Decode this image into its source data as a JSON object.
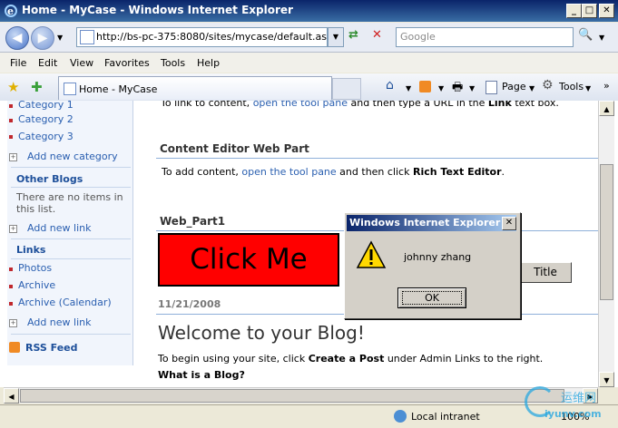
{
  "window": {
    "title": "Home - MyCase - Windows Internet Explorer",
    "caption_buttons": [
      "_",
      "□",
      "✕"
    ]
  },
  "address": {
    "url": "http://bs-pc-375:8080/sites/mycase/default.aspx"
  },
  "search": {
    "placeholder": "Google"
  },
  "menu": [
    "File",
    "Edit",
    "View",
    "Favorites",
    "Tools",
    "Help"
  ],
  "tab": {
    "label": "Home - MyCase"
  },
  "toolbar": {
    "page_label": "Page",
    "tools_label": "Tools"
  },
  "leftnav": {
    "categories": [
      "Category 1",
      "Category 2",
      "Category 3"
    ],
    "add_category": "Add new category",
    "other_blogs_heading": "Other Blogs",
    "other_blogs_empty": [
      "There are no items in",
      "this list."
    ],
    "add_link": "Add new link",
    "links_heading": "Links",
    "links": [
      "Photos",
      "Archive",
      "Archive (Calendar)"
    ],
    "add_link2": "Add new link",
    "rss": "RSS Feed"
  },
  "main": {
    "top_partial": {
      "before": "To link to content, ",
      "link": "open the tool pane",
      "middle": " and then type a URL in the ",
      "bold": "Link",
      "after": " text box."
    },
    "cewp_title": "Content Editor Web Part",
    "cewp_text": {
      "before": "To add content, ",
      "link": "open the tool pane",
      "middle": " and then click ",
      "bold": "Rich Text Editor",
      "after": "."
    },
    "webpart1_title": "Web_Part1",
    "click_me": "Click Me",
    "title_button": "Title",
    "date": "11/21/2008",
    "welcome": "Welcome to your Blog!",
    "begin_text": {
      "before": "To begin using your site, click ",
      "bold": "Create a Post",
      "after": " under Admin Links to the right."
    },
    "what_is": "What is a Blog?"
  },
  "dialog": {
    "title": "Windows Internet Explorer",
    "message": "johnny zhang",
    "ok": "OK",
    "close": "✕"
  },
  "status": {
    "zone": "Local intranet",
    "zoom": "100%"
  },
  "watermark": {
    "text": "运维网",
    "url": "iyunv.com"
  },
  "colors": {
    "click_me_bg": "#ff0000",
    "title_bar": "#0a246a",
    "link": "#2a5fb0"
  }
}
